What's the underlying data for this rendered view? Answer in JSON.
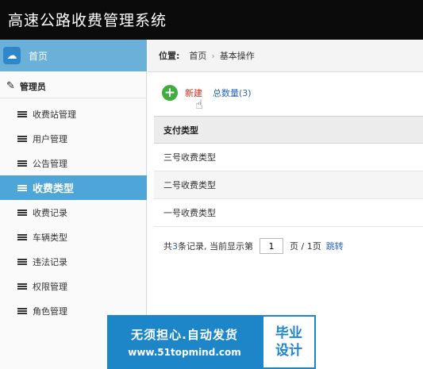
{
  "app": {
    "title": "高速公路收费管理系统"
  },
  "sidebar": {
    "home_label": "首页",
    "group_label": "管理员",
    "items": [
      {
        "label": "收费站管理",
        "active": false
      },
      {
        "label": "用户管理",
        "active": false
      },
      {
        "label": "公告管理",
        "active": false
      },
      {
        "label": "收费类型",
        "active": true
      },
      {
        "label": "收费记录",
        "active": false
      },
      {
        "label": "车辆类型",
        "active": false
      },
      {
        "label": "违法记录",
        "active": false
      },
      {
        "label": "权限管理",
        "active": false
      },
      {
        "label": "角色管理",
        "active": false
      }
    ]
  },
  "breadcrumb": {
    "label": "位置:",
    "home": "首页",
    "separator": "›",
    "current": "基本操作"
  },
  "toolbar": {
    "add_label": "新建",
    "total_label": "总数量(3)"
  },
  "table": {
    "header": "支付类型",
    "rows": [
      "三号收费类型",
      "二号收费类型",
      "一号收费类型"
    ]
  },
  "pager": {
    "prefix": "共",
    "count": "3",
    "mid": "条记录, 当前显示第",
    "page_value": "1",
    "suffix": "页 / 1页",
    "jump_label": "跳转"
  },
  "banner": {
    "line1": "无须担心.自动发货",
    "line2": "www.51topmind.com",
    "right_top": "毕业",
    "right_bottom": "设计"
  },
  "colors": {
    "accent": "#4ea6d8",
    "header": "#0b0b0b",
    "add_green": "#3fae3f",
    "link_blue": "#2a64b8",
    "banner_blue": "#1d86c9"
  }
}
